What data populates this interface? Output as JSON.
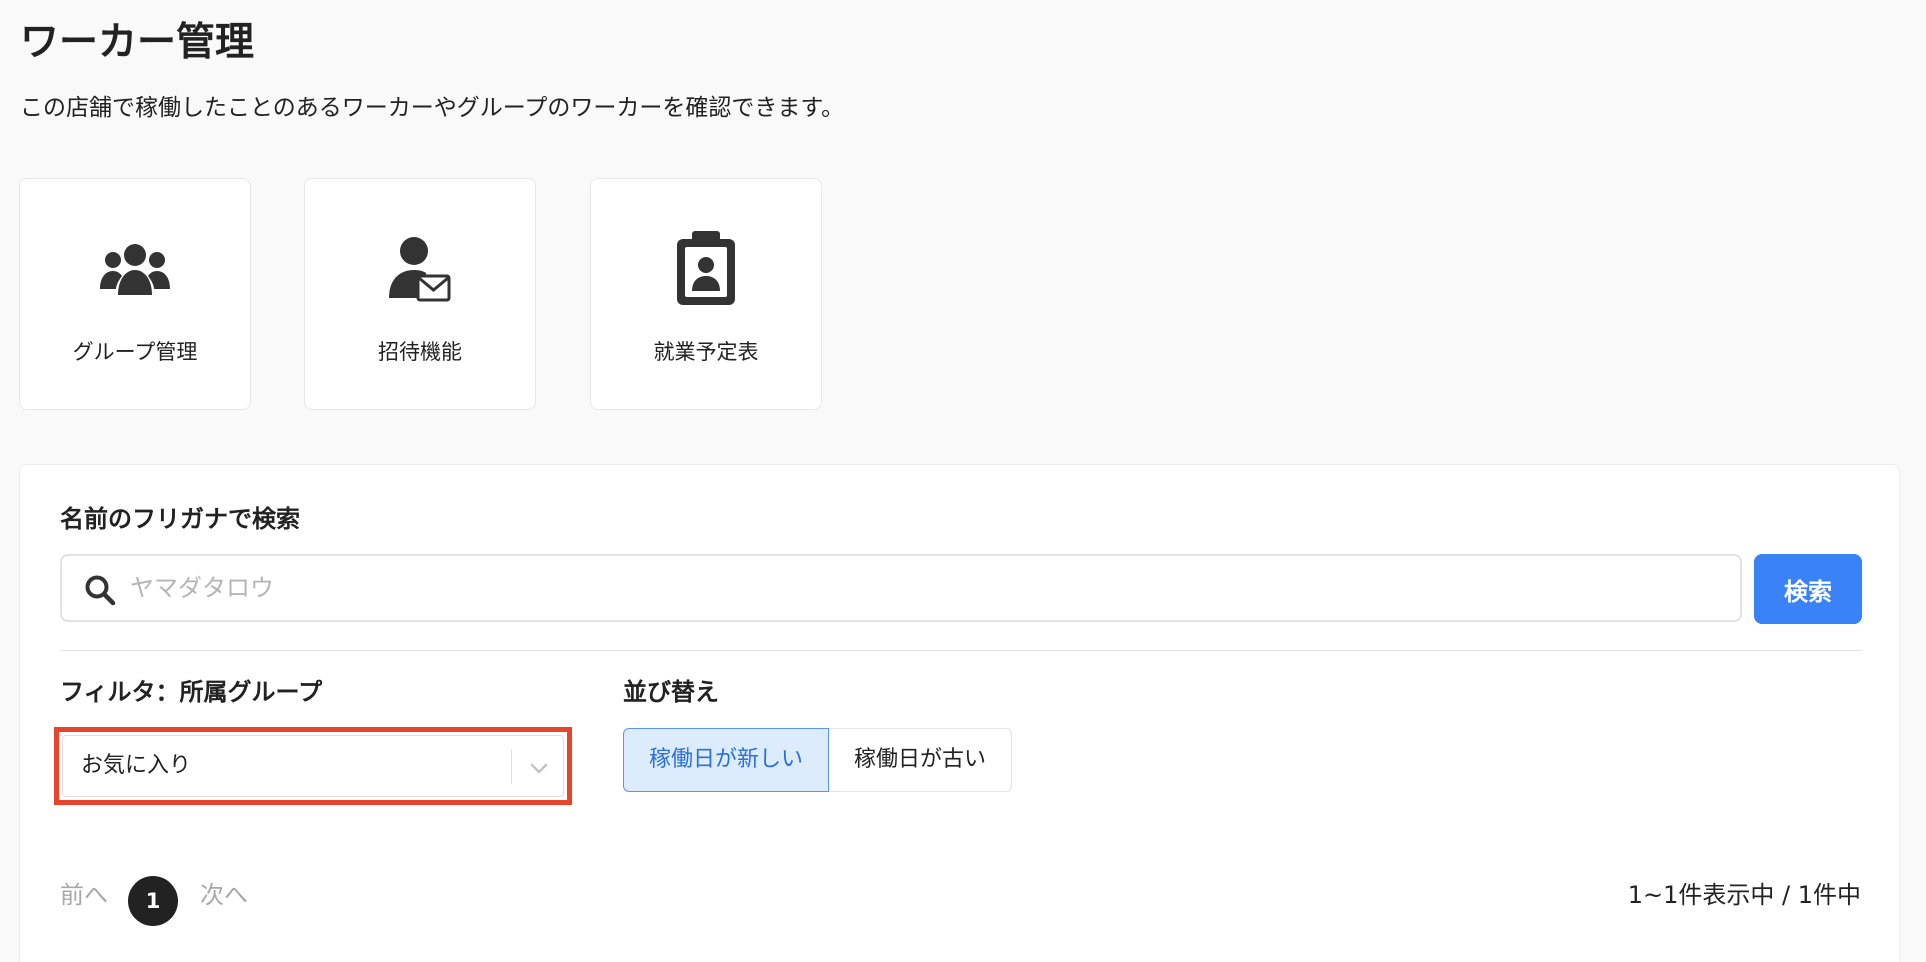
{
  "header": {
    "title": "ワーカー管理",
    "description": "この店舗で稼働したことのあるワーカーやグループのワーカーを確認できます。"
  },
  "feature_cards": [
    {
      "label": "グループ管理",
      "icon": "users-group-icon"
    },
    {
      "label": "招待機能",
      "icon": "user-invite-mail-icon"
    },
    {
      "label": "就業予定表",
      "icon": "clipboard-user-icon"
    }
  ],
  "search": {
    "label": "名前のフリガナで検索",
    "placeholder": "ヤマダタロウ",
    "value": "",
    "button_label": "検索"
  },
  "filter": {
    "label": "フィルタ：所属グループ",
    "selected": "お気に入り"
  },
  "sort": {
    "label": "並び替え",
    "options": [
      "稼働日が新しい",
      "稼働日が古い"
    ],
    "active_index": 0
  },
  "pagination": {
    "prev_label": "前へ",
    "current_page": "1",
    "next_label": "次へ",
    "summary": "1~1件表示中 / 1件中"
  },
  "colors": {
    "accent": "#3a82f7",
    "highlight_border": "#e8442b",
    "active_sort_bg": "#dcecfd"
  }
}
